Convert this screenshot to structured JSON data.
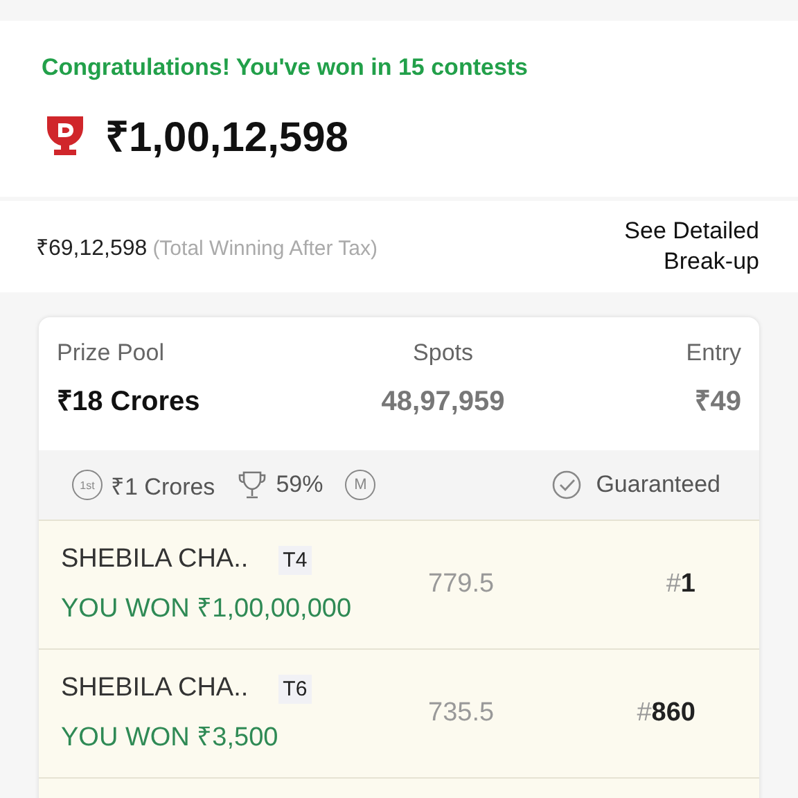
{
  "summary": {
    "headline": "Congratulations! You've won in 15 contests",
    "total": "₹1,00,12,598",
    "after_tax_amount": "₹69,12,598",
    "after_tax_note": "(Total Winning After Tax)",
    "breakup_link": "See Detailed Break-up"
  },
  "contest": {
    "columns": [
      {
        "label": "Prize Pool",
        "value": "₹18 Crores",
        "kind": "strong"
      },
      {
        "label": "Spots",
        "value": "48,97,959",
        "kind": "muted"
      },
      {
        "label": "Entry",
        "value": "₹49",
        "kind": "muted"
      }
    ],
    "info": {
      "first_badge": "1st",
      "first_prize": "₹1 Crores",
      "win_share": "59%",
      "multi_badge": "M",
      "guarantee": "Guaranteed"
    },
    "entries": [
      {
        "name": "SHEBILA CHA..",
        "team": "T4",
        "won": "YOU WON ₹1,00,00,000",
        "points": "779.5",
        "rank_mark": "#",
        "rank": "1"
      },
      {
        "name": "SHEBILA CHA..",
        "team": "T6",
        "won": "YOU WON ₹3,500",
        "points": "735.5",
        "rank_mark": "#",
        "rank": "860"
      }
    ]
  }
}
